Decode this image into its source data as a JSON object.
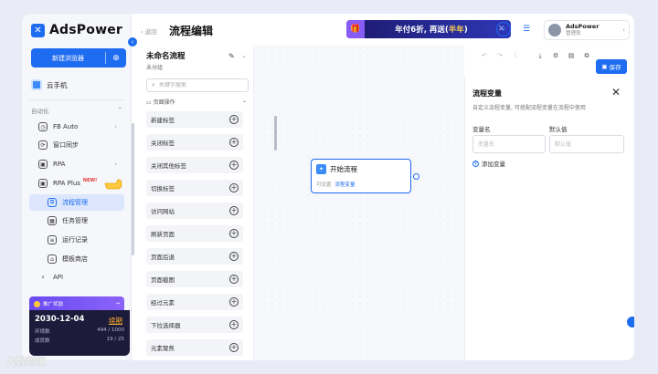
{
  "brand": {
    "name": "AdsPower"
  },
  "sidebar": {
    "new_browser": "新建浏览器",
    "cloud_phone": "云手机",
    "section_automation": "自动化",
    "items": [
      {
        "label": "FB Auto",
        "chevron": "›"
      },
      {
        "label": "窗口同步"
      },
      {
        "label": "RPA",
        "chevron": "›"
      },
      {
        "label": "RPA Plus",
        "badge": "NEW!",
        "chevron": "⌄"
      },
      {
        "label": "流程管理",
        "active": true
      },
      {
        "label": "任务管理"
      },
      {
        "label": "运行记录"
      },
      {
        "label": "模板商店"
      },
      {
        "label": "API"
      }
    ],
    "promo": {
      "label": "推广奖励",
      "arrow": "→"
    },
    "account": {
      "date": "2030-12-04",
      "renew": "续期",
      "env_label": "环境数",
      "env_value": "494 / 1000",
      "member_label": "成员数",
      "member_value": "19 / 25"
    }
  },
  "header": {
    "back": "‹ 返回",
    "title": "流程编辑",
    "banner": {
      "text_a": "年付6折, 再送(",
      "text_hl": "半年",
      "text_b": ")"
    },
    "user": {
      "name": "AdsPower",
      "role": "管理员"
    }
  },
  "flow": {
    "name": "未命名流程",
    "group": "未分组",
    "search_placeholder": "关键字搜索",
    "category": "页面操作",
    "ops": [
      "新建标签",
      "关闭标签",
      "关闭其他标签",
      "切换标签",
      "访问网站",
      "刷新页面",
      "页面后退",
      "页面截图",
      "经过元素",
      "下拉选择器",
      "元素聚焦"
    ]
  },
  "canvas": {
    "node": {
      "title": "开始流程",
      "meta_label": "可设置",
      "meta_link": "流程变量"
    }
  },
  "toolbar": {
    "save": "保存"
  },
  "vars": {
    "title": "流程变量",
    "desc": "自定义流程变量, 可搭配流程变量在流程中使用",
    "col_name": "变量名",
    "col_default": "默认值",
    "name_placeholder": "变量名",
    "default_placeholder": "默认值",
    "add": "添加变量"
  },
  "watermark": "大数跨境",
  "colors": {
    "accent": "#1e6cf0",
    "banner": "#1c1a6e",
    "highlight": "#ffd34d"
  }
}
